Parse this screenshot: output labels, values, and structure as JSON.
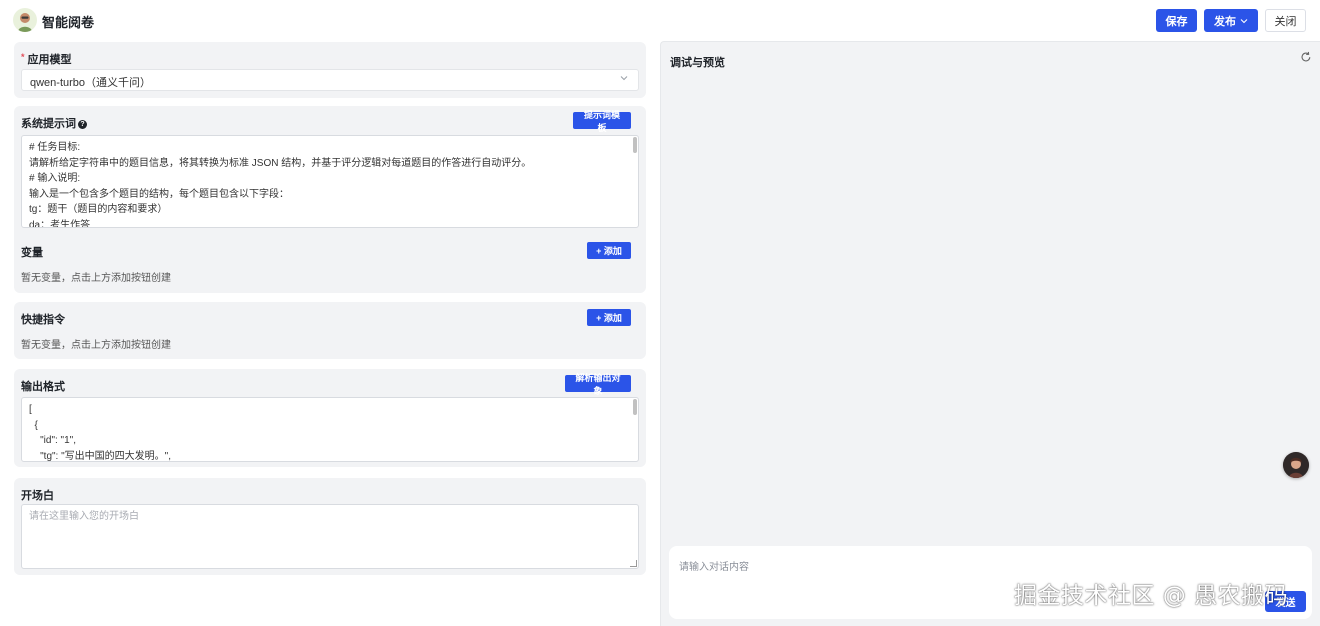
{
  "header": {
    "app_title": "智能阅卷",
    "save_label": "保存",
    "publish_label": "发布",
    "close_label": "关闭"
  },
  "model_section": {
    "title": "应用模型",
    "selected_value": "qwen-turbo（通义千问）"
  },
  "system_prompt": {
    "title": "系统提示词",
    "template_button": "提示词模板",
    "lines": [
      "# 任务目标:",
      "请解析给定字符串中的题目信息，将其转换为标准 JSON 结构，并基于评分逻辑对每道题目的作答进行自动评分。",
      "# 输入说明:",
      "输入是一个包含多个题目的结构，每个题目包含以下字段：",
      "tg：题干（题目的内容和要求）",
      "da：考生作答"
    ]
  },
  "variables": {
    "title": "变量",
    "add_label": "+ 添加",
    "empty_text": "暂无变量，点击上方添加按钮创建"
  },
  "shortcuts": {
    "title": "快捷指令",
    "add_label": "+ 添加",
    "empty_text": "暂无变量，点击上方添加按钮创建"
  },
  "output_format": {
    "title": "输出格式",
    "parse_button": "解析输出对象",
    "lines": [
      "[",
      "  {",
      "    \"id\": \"1\",",
      "    \"tg\": \"写出中国的四大发明。\","
    ]
  },
  "opening": {
    "title": "开场白",
    "placeholder": "请在这里输入您的开场白"
  },
  "preview": {
    "title": "调试与预览",
    "input_placeholder": "请输入对话内容",
    "send_label": "发送"
  },
  "watermark": "掘金技术社区 @ 愚农搬码",
  "colors": {
    "primary": "#2b54e8",
    "panel_bg": "#f2f3f5"
  }
}
